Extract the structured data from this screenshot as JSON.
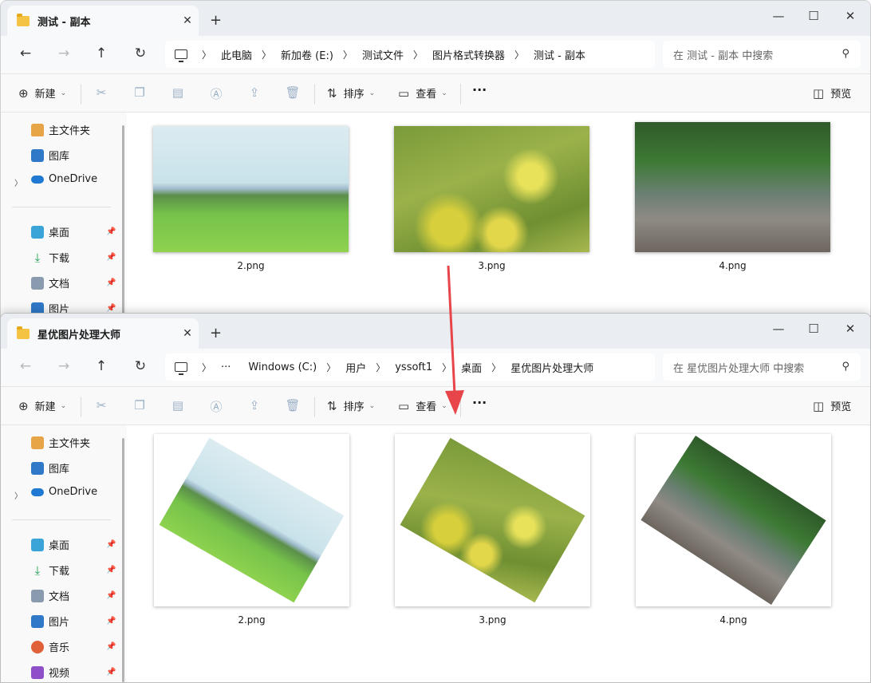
{
  "top_window": {
    "tab_title": "测试 - 副本",
    "breadcrumbs": [
      "此电脑",
      "新加卷 (E:)",
      "测试文件",
      "图片格式转换器",
      "测试 - 副本"
    ],
    "search_placeholder": "在 测试 - 副本 中搜索",
    "files": [
      {
        "name": "2.png",
        "image": "meadow"
      },
      {
        "name": "3.png",
        "image": "flowers"
      },
      {
        "name": "4.png",
        "image": "river"
      }
    ]
  },
  "bottom_window": {
    "tab_title": "星优图片处理大师",
    "breadcrumbs": [
      "Windows (C:)",
      "用户",
      "yssoft1",
      "桌面",
      "星优图片处理大师"
    ],
    "breadcrumb_overflow": "···",
    "search_placeholder": "在 星优图片处理大师 中搜索",
    "files": [
      {
        "name": "2.png",
        "image": "meadow-rotated"
      },
      {
        "name": "3.png",
        "image": "flowers-rotated"
      },
      {
        "name": "4.png",
        "image": "river-rotated"
      }
    ]
  },
  "toolbar": {
    "new_label": "新建",
    "sort_label": "排序",
    "view_label": "查看",
    "more_label": "···",
    "preview_label": "预览"
  },
  "sidebar": {
    "home": "主文件夹",
    "gallery": "图库",
    "onedrive": "OneDrive",
    "desktop": "桌面",
    "downloads": "下载",
    "documents": "文档",
    "pictures": "图片",
    "music": "音乐",
    "videos": "视频"
  },
  "colors": {
    "arrow": "#e8454a",
    "folder": "#f4c343",
    "onedrive": "#1f78d1"
  }
}
